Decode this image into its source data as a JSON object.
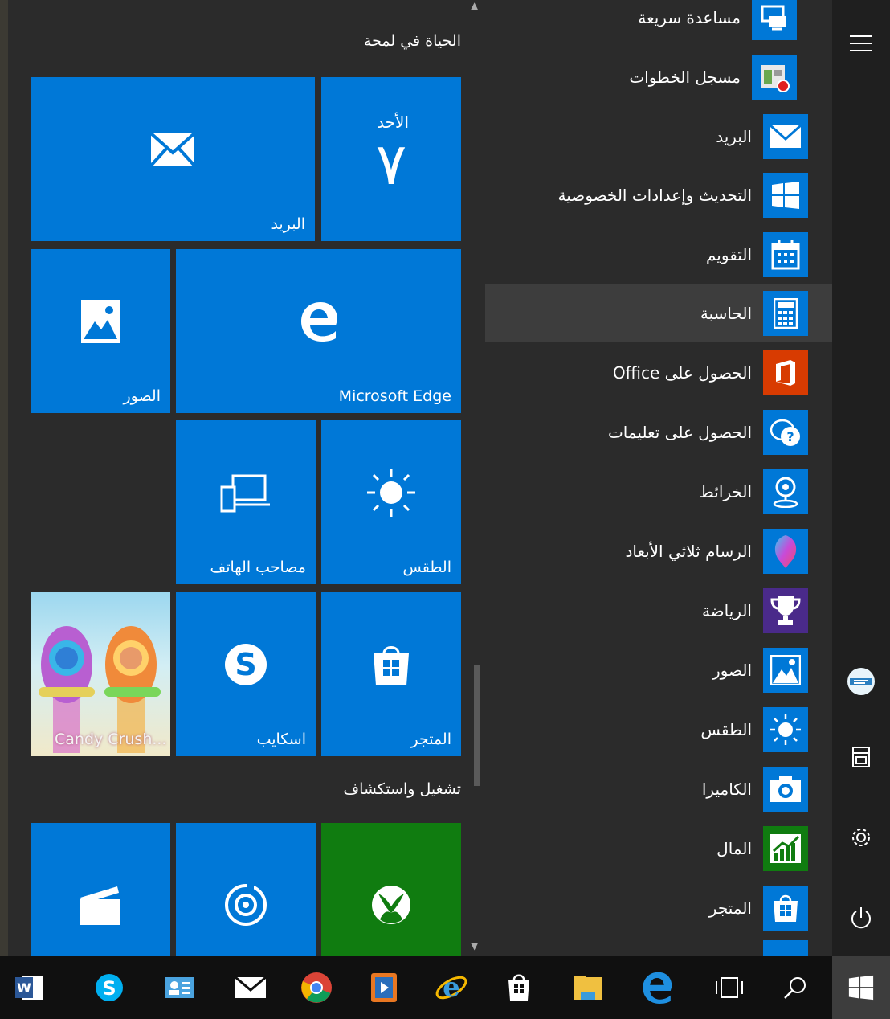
{
  "groups": {
    "life": "الحياة في لمحة",
    "play": "تشغيل واستكشاف"
  },
  "tiles": {
    "mail": "البريد",
    "calendar_day": "الأحد",
    "calendar_date": "٧",
    "photos": "الصور",
    "edge": "Microsoft Edge",
    "phone": "مصاحب الهاتف",
    "weather": "الطقس",
    "candy": "Candy Crush...",
    "skype": "اسكايب",
    "store": "المتجر"
  },
  "apps": [
    {
      "label": "مساعدة سريعة",
      "icon": "quick-assist-icon"
    },
    {
      "label": "مسجل الخطوات",
      "icon": "steps-recorder-icon"
    },
    {
      "label": "البريد",
      "icon": "mail-icon"
    },
    {
      "label": "التحديث وإعدادات الخصوصية",
      "icon": "windows-logo-icon"
    },
    {
      "label": "التقويم",
      "icon": "calendar-icon"
    },
    {
      "label": "الحاسبة",
      "icon": "calculator-icon"
    },
    {
      "label": "الحصول على Office",
      "icon": "office-icon"
    },
    {
      "label": "الحصول على تعليمات",
      "icon": "help-icon"
    },
    {
      "label": "الخرائط",
      "icon": "maps-icon"
    },
    {
      "label": "الرسام ثلاثي الأبعاد",
      "icon": "paint3d-icon"
    },
    {
      "label": "الرياضة",
      "icon": "trophy-icon"
    },
    {
      "label": "الصور",
      "icon": "photos-icon"
    },
    {
      "label": "الطقس",
      "icon": "weather-icon"
    },
    {
      "label": "الكاميرا",
      "icon": "camera-icon"
    },
    {
      "label": "المال",
      "icon": "money-icon"
    },
    {
      "label": "المتجر",
      "icon": "store-icon"
    }
  ],
  "colors": {
    "accent": "#0078d7",
    "xbox": "#107c10",
    "office": "#d83b01",
    "panel": "#2b2b2b",
    "taskbar": "#101010"
  }
}
